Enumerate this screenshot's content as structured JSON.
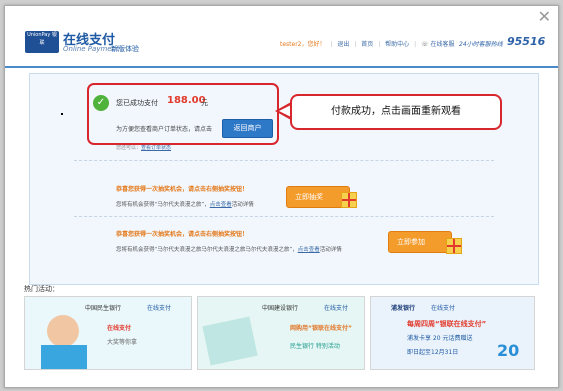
{
  "header": {
    "logo_text": "UnionPay 银联",
    "brand_title": "在线支付",
    "brand_subtitle": "Online Payment",
    "version_label": "新版体验",
    "user": "tester2，您好！",
    "nav": [
      "退出",
      "首页",
      "帮助中心"
    ],
    "online_service": "在线客服",
    "hotline_label": "24小时客服热线",
    "hotline_number": "95516"
  },
  "result": {
    "success_label": "您已成功支付",
    "amount": "188.00",
    "unit": "元",
    "order_hint": "为方便您查看商户订单状态，请点击",
    "return_button": "返回商户",
    "note_prefix": "您还可以：",
    "note_link": "查看订单状态"
  },
  "callout": {
    "text": "付款成功，点击画面重新观看"
  },
  "promos": [
    {
      "title": "恭喜您获得一次抽奖机会，请点击右侧抽奖按钮！",
      "desc_prefix": "您将有机会获得“马尔代夫浪漫之旅”，",
      "link": "点击查看",
      "desc_suffix": "活动详情",
      "button": "立即抽奖"
    },
    {
      "title": "恭喜您获得一次抽奖机会，请点击右侧抽奖按钮！",
      "desc_prefix": "您将有机会获得“马尔代夫浪漫之旅马尔代夫浪漫之旅马尔代夫浪漫之旅”，",
      "link": "点击查看",
      "desc_suffix": "活动详情",
      "button": "立即参加"
    }
  ],
  "activities": {
    "label": "热门活动：",
    "banners": [
      {
        "bank": "中国民生银行",
        "partner": "在线支付",
        "line1": "在线支付",
        "line2": "大奖等你拿"
      },
      {
        "bank": "中国建设银行",
        "partner": "在线支付",
        "line1": "网购用“银联在线支付”",
        "line2": "民生银行 特别活动"
      },
      {
        "bank": "浦发银行",
        "partner": "在线支付",
        "line1": "每周四周“银联在线支付”",
        "line2": "浦发卡享 20 元话费赠送",
        "line3": "即日起至12月31日",
        "badge": "20"
      }
    ]
  }
}
